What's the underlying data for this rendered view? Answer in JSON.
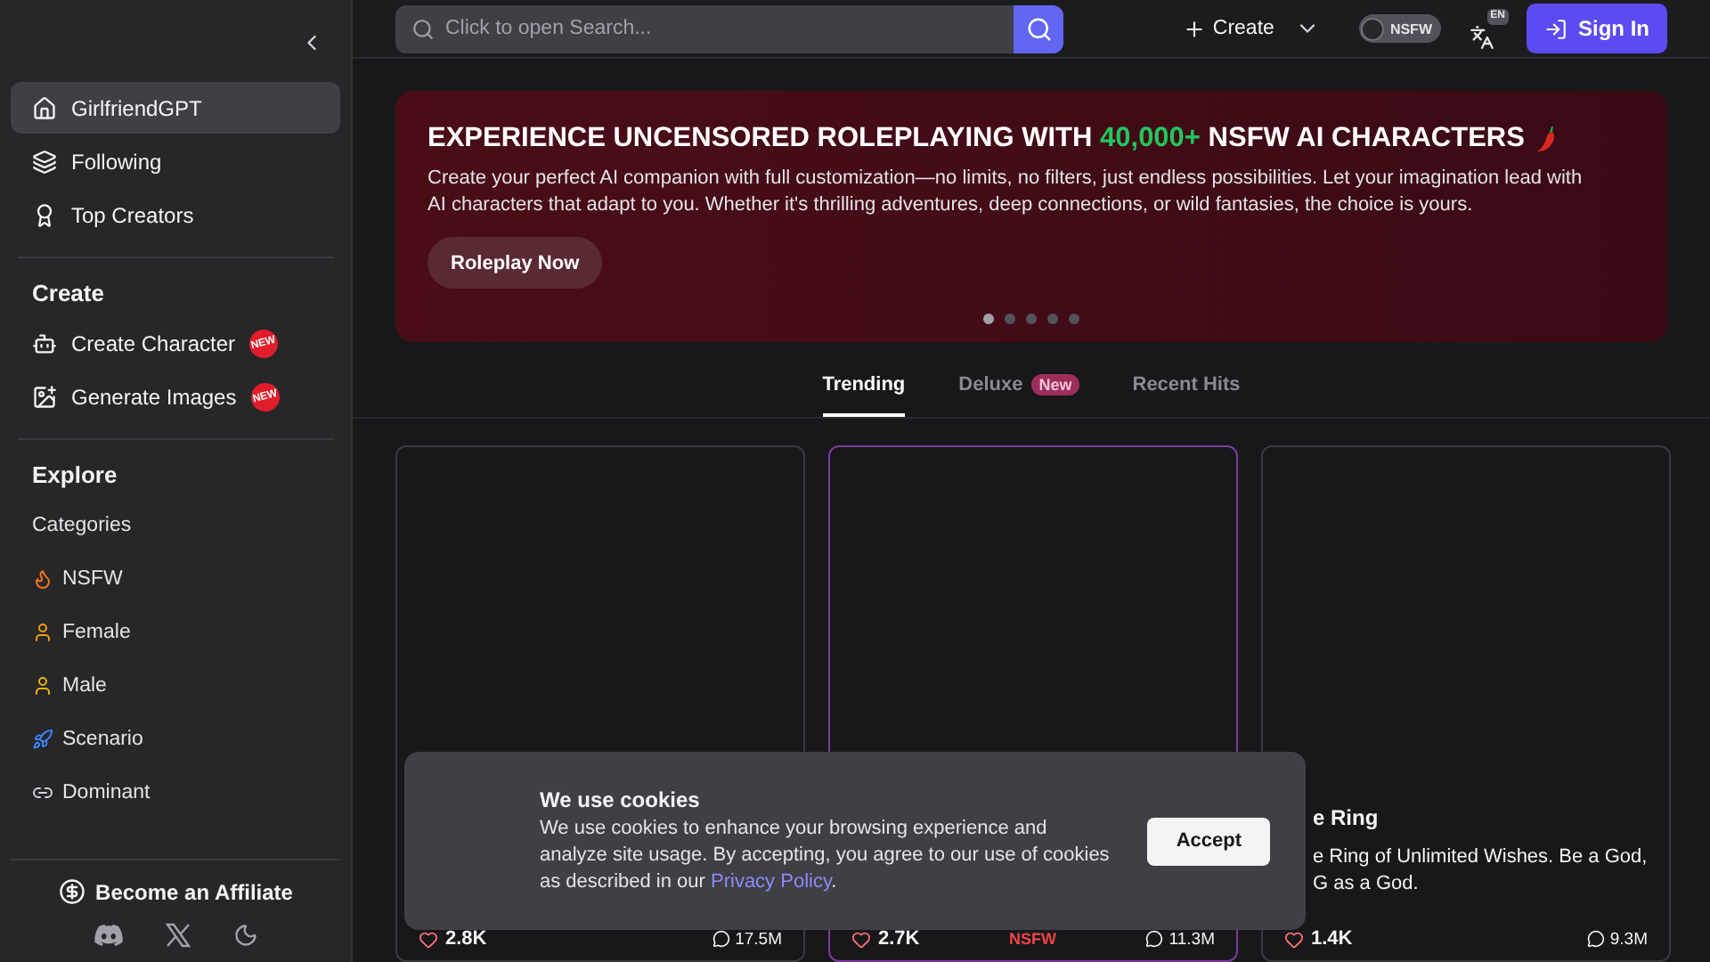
{
  "sidebar": {
    "nav": [
      {
        "label": "GirlfriendGPT",
        "selected": true
      },
      {
        "label": "Following",
        "selected": false
      },
      {
        "label": "Top Creators",
        "selected": false
      }
    ],
    "create_heading": "Create",
    "create_items": [
      {
        "label": "Create Character",
        "badge": "NEW"
      },
      {
        "label": "Generate Images",
        "badge": "NEW"
      }
    ],
    "explore_heading": "Explore",
    "categories_label": "Categories",
    "categories": [
      {
        "label": "NSFW"
      },
      {
        "label": "Female"
      },
      {
        "label": "Male"
      },
      {
        "label": "Scenario"
      },
      {
        "label": "Dominant"
      }
    ],
    "affiliate": "Become an Affiliate"
  },
  "header": {
    "search_placeholder": "Click to open Search...",
    "create": "Create",
    "nsfw_toggle": {
      "label": "NSFW",
      "on": false
    },
    "language": "EN",
    "sign_in": "Sign In"
  },
  "banner": {
    "title_before": "EXPERIENCE UNCENSORED ROLEPLAYING WITH ",
    "title_highlight": "40,000+",
    "title_after": " NSFW AI CHARACTERS",
    "text": "Create your perfect AI companion with full customization—no limits, no filters, just endless possibilities. Let your imagination lead with AI characters that adapt to you. Whether it's thrilling adventures, deep connections, or wild fantasies, the choice is yours.",
    "button": "Roleplay Now",
    "dots": [
      {
        "selected": true
      },
      {
        "selected": false
      },
      {
        "selected": false
      },
      {
        "selected": false
      },
      {
        "selected": false
      }
    ]
  },
  "tabs": [
    {
      "label": "Trending",
      "selected": true
    },
    {
      "label": "Deluxe",
      "badge": "New",
      "selected": false
    },
    {
      "label": "Recent Hits",
      "selected": false
    }
  ],
  "cards": [
    {
      "highlighted": false,
      "likes": "2.8K",
      "messages": "17.5M"
    },
    {
      "highlighted": true,
      "likes": "2.7K",
      "tag": "NSFW",
      "messages": "11.3M"
    },
    {
      "highlighted": false,
      "title": "e Ring",
      "description": "e Ring of Unlimited Wishes. Be a God,",
      "description_2": "G as a God.",
      "likes": "1.4K",
      "messages": "9.3M"
    }
  ],
  "cookie": {
    "title": "We use cookies",
    "text": "We use cookies to enhance your browsing experience and analyze site usage. By accepting, you agree to our use of cookies as described in our ",
    "link": "Privacy Policy",
    "after": ".",
    "button": "Accept"
  }
}
